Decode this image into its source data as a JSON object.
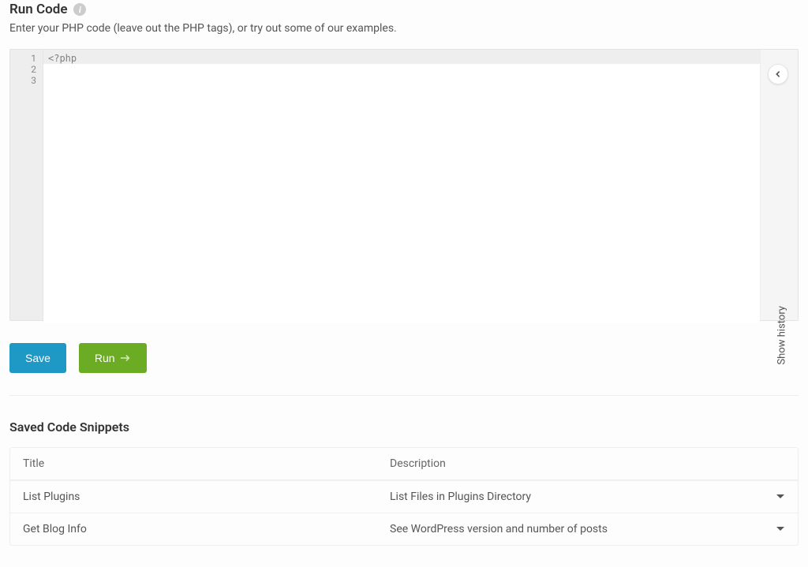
{
  "header": {
    "title": "Run Code",
    "subtitle": "Enter your PHP code (leave out the PHP tags), or try out some of our examples."
  },
  "editor": {
    "line_numbers": [
      "1",
      "2",
      "3"
    ],
    "first_line": "<?php",
    "show_history_label": "Show history"
  },
  "actions": {
    "save_label": "Save",
    "run_label": "Run"
  },
  "snippets": {
    "section_title": "Saved Code Snippets",
    "columns": {
      "title": "Title",
      "description": "Description"
    },
    "rows": [
      {
        "title": "List Plugins",
        "description": "List Files in Plugins Directory"
      },
      {
        "title": "Get Blog Info",
        "description": "See WordPress version and number of posts"
      }
    ]
  }
}
